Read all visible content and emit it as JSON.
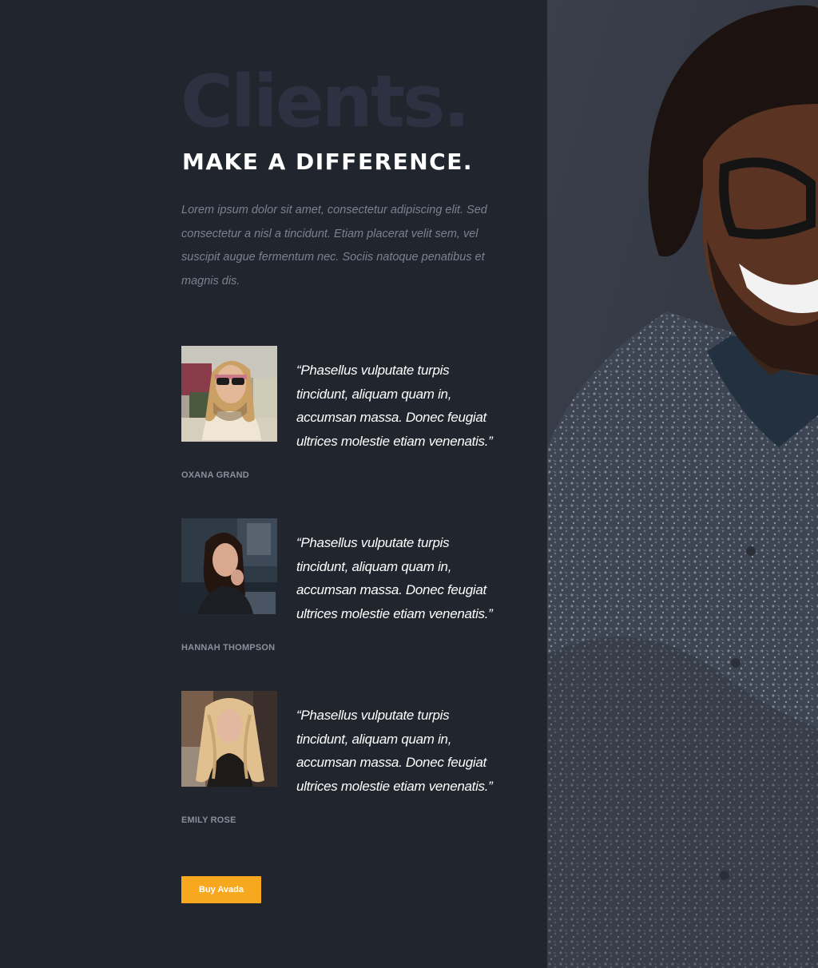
{
  "section": {
    "background_word": "Clients.",
    "headline": "MAKE A DIFFERENCE.",
    "intro": "Lorem ipsum dolor sit amet, consectetur adipiscing elit. Sed consectetur a nisl a tincidunt. Etiam placerat velit sem, vel suscipit augue fermentum nec. Sociis natoque penatibus et magnis dis."
  },
  "testimonials": [
    {
      "quote": "“Phasellus vulputate turpis tincidunt, aliquam quam in, accumsan massa. Donec feugiat ultrices molestie etiam venenatis.”",
      "author": "OXANA GRAND"
    },
    {
      "quote": "“Phasellus vulputate turpis tincidunt, aliquam quam in, accumsan massa. Donec feugiat ultrices molestie etiam venenatis.”",
      "author": "HANNAH THOMPSON"
    },
    {
      "quote": "“Phasellus vulputate turpis tincidunt, aliquam quam in, accumsan massa. Donec feugiat ultrices molestie etiam venenatis.”",
      "author": "EMILY ROSE"
    }
  ],
  "cta": {
    "label": "Buy Avada"
  },
  "colors": {
    "background": "#21252e",
    "background_word": "#2c3242",
    "accent": "#f7a81e",
    "muted_text": "#7b8190",
    "author_text": "#8a8f9b"
  }
}
